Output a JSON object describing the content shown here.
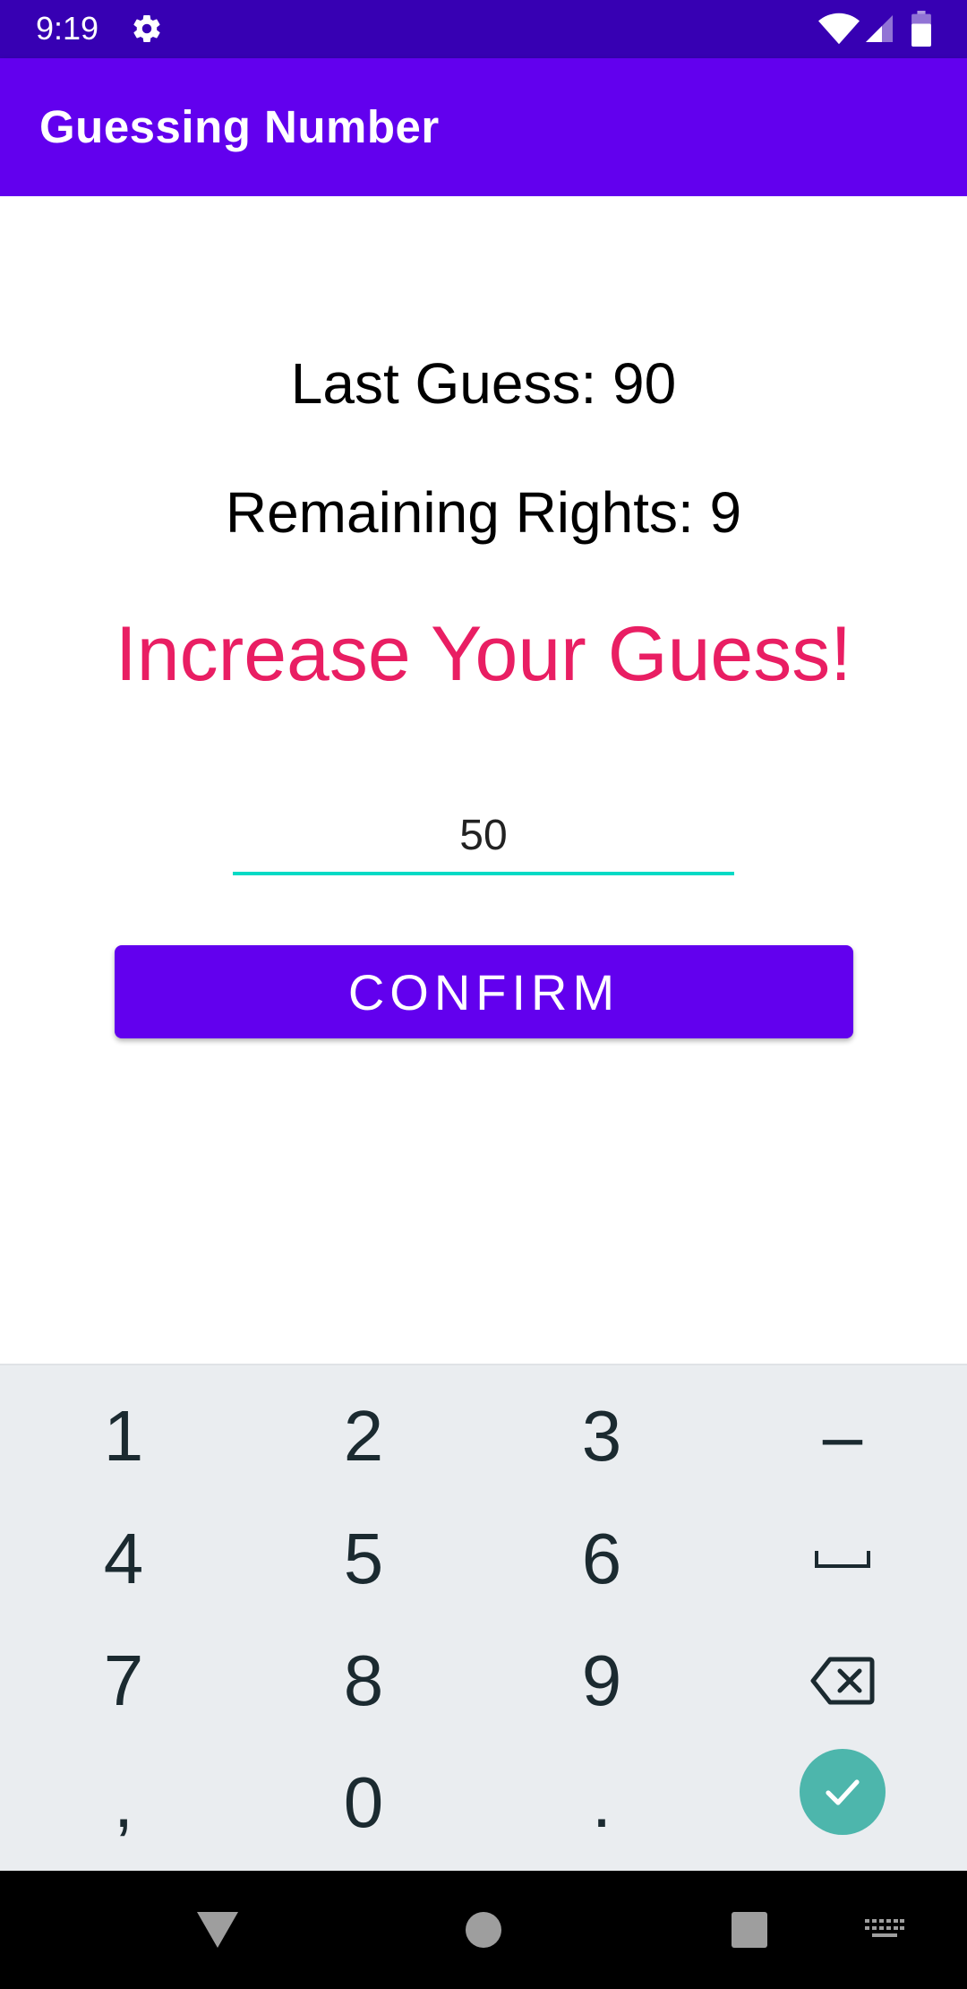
{
  "status_bar": {
    "time": "9:19",
    "icons": [
      "gear-icon",
      "wifi-icon",
      "signal-icon",
      "battery-icon"
    ],
    "background": "#3700b3"
  },
  "app_bar": {
    "title": "Guessing Number",
    "background": "#6200ee"
  },
  "game": {
    "last_guess": "Last Guess: 90",
    "remaining_rights": "Remaining Rights: 9",
    "hint": "Increase Your Guess!",
    "hint_color": "#e91e63"
  },
  "guess_input": {
    "value": "50",
    "underline_color": "#03dac5"
  },
  "confirm_button": {
    "label": "CONFIRM",
    "color": "#6200ee"
  },
  "keyboard": {
    "keys": [
      "1",
      "2",
      "3",
      "-",
      "4",
      "5",
      "6",
      "space",
      "7",
      "8",
      "9",
      "backspace",
      ",",
      "0",
      ".",
      "done"
    ],
    "labels": {
      "k1": "1",
      "k2": "2",
      "k3": "3",
      "kminus": "–",
      "k4": "4",
      "k5": "5",
      "k6": "6",
      "k7": "7",
      "k8": "8",
      "k9": "9",
      "kcomma": ",",
      "k0": "0",
      "kdot": "."
    },
    "done_color": "#4db6ac",
    "background": "#eaedf0"
  },
  "nav_bar": {
    "icons": [
      "back-icon",
      "home-icon",
      "recents-icon",
      "keyboard-switch-icon"
    ]
  }
}
